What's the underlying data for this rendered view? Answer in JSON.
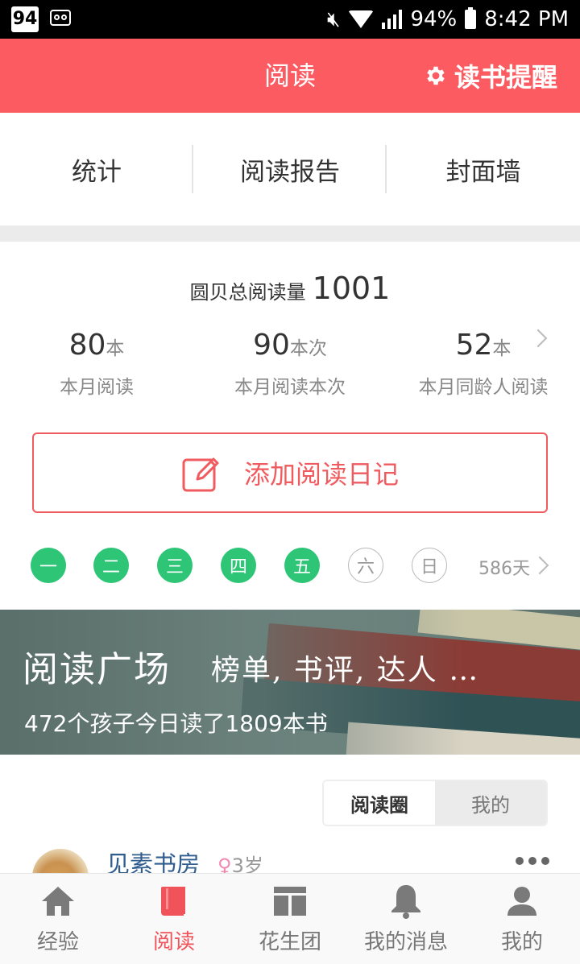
{
  "status_bar": {
    "badge": "94",
    "battery": "94%",
    "time": "8:42 PM"
  },
  "header": {
    "title": "阅读",
    "reminder_label": "读书提醒"
  },
  "tabs": [
    {
      "label": "统计"
    },
    {
      "label": "阅读报告"
    },
    {
      "label": "封面墙"
    }
  ],
  "stats": {
    "total_label": "圆贝总阅读量",
    "total_value": "1001",
    "items": [
      {
        "value": "80",
        "unit": "本",
        "caption": "本月阅读"
      },
      {
        "value": "90",
        "unit": "本次",
        "caption": "本月阅读本次"
      },
      {
        "value": "52",
        "unit": "本",
        "caption": "本月同龄人阅读"
      }
    ]
  },
  "diary_button": {
    "label": "添加阅读日记"
  },
  "week": {
    "days": [
      {
        "label": "一",
        "done": true
      },
      {
        "label": "二",
        "done": true
      },
      {
        "label": "三",
        "done": true
      },
      {
        "label": "四",
        "done": true
      },
      {
        "label": "五",
        "done": true
      },
      {
        "label": "六",
        "done": false
      },
      {
        "label": "日",
        "done": false
      }
    ],
    "streak": "586天"
  },
  "banner": {
    "title": "阅读广场",
    "subtitle": "榜单, 书评, 达人 …",
    "caption": "472个孩子今日读了1809本书"
  },
  "segment": {
    "options": [
      "阅读圈",
      "我的"
    ],
    "selected": "阅读圈"
  },
  "feed": {
    "user_name": "见素书房",
    "gender_symbol": "♀",
    "age": "3岁"
  },
  "bottom_nav": [
    {
      "label": "经验",
      "icon": "home-icon",
      "active": false
    },
    {
      "label": "阅读",
      "icon": "book-icon",
      "active": true
    },
    {
      "label": "花生团",
      "icon": "group-icon",
      "active": false
    },
    {
      "label": "我的消息",
      "icon": "bell-icon",
      "active": false
    },
    {
      "label": "我的",
      "icon": "person-icon",
      "active": false
    }
  ],
  "colors": {
    "brand": "#fb5b61",
    "accent_green": "#2ec676",
    "link_blue": "#2f5d8f"
  }
}
